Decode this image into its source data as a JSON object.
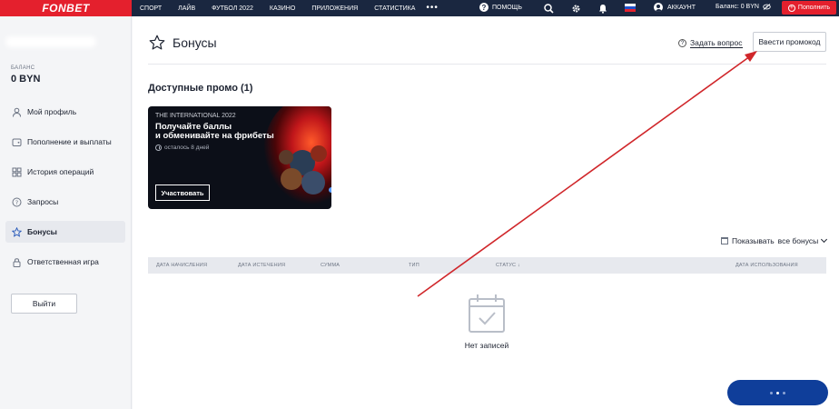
{
  "topbar": {
    "logo": "FONBET",
    "nav": [
      "СПОРТ",
      "ЛАЙВ",
      "ФУТБОЛ 2022",
      "КАЗИНО",
      "ПРИЛОЖЕНИЯ",
      "СТАТИСТИКА"
    ],
    "more": "•••",
    "help": "ПОМОЩЬ",
    "account": "АККАУНТ",
    "balance": "Баланс: 0 BYN",
    "deposit": "Пополнить",
    "icons": [
      "help-icon",
      "search-icon",
      "gear-icon",
      "bell-icon",
      "flag-icon",
      "account-icon",
      "eye-off-icon",
      "plus-circle-icon"
    ],
    "flag_colors": [
      "#ffffff",
      "#1e50c8",
      "#e4202d"
    ]
  },
  "sidebar": {
    "balance_label": "БАЛАНС",
    "balance_value": "0 BYN",
    "items": [
      {
        "label": "Мой профиль",
        "icon": "user-icon"
      },
      {
        "label": "Пополнение и выплаты",
        "icon": "wallet-icon"
      },
      {
        "label": "История операций",
        "icon": "grid-icon"
      },
      {
        "label": "Запросы",
        "icon": "question-icon"
      },
      {
        "label": "Бонусы",
        "icon": "star-icon",
        "active": true
      },
      {
        "label": "Ответственная игра",
        "icon": "lock-icon"
      }
    ],
    "logout": "Выйти"
  },
  "page": {
    "title": "Бонусы",
    "ask": "Задать вопрос",
    "promo_button": "Ввести промокод",
    "available_promos": "Доступные промо (1)"
  },
  "promo_card": {
    "event": "THE INTERNATIONAL 2022",
    "title_line1": "Получайте баллы",
    "title_line2": "и обменивайте на фрибеты",
    "time_left": "осталось 8 дней",
    "button": "Участвовать"
  },
  "filter": {
    "label": "Показывать",
    "value": "все бонусы"
  },
  "table": {
    "columns": [
      "ДАТА НАЧИСЛЕНИЯ",
      "ДАТА ИСТЕЧЕНИЯ",
      "СУММА",
      "ТИП",
      "СТАТУС ↓",
      "ДАТА ИСПОЛЬЗОВАНИЯ"
    ]
  },
  "empty": {
    "text": "Нет записей"
  },
  "colors": {
    "brand_red": "#e4202d",
    "nav_dark": "#1a2740",
    "loader_blue": "#0f3e9a",
    "annotation_arrow": "#d0262a"
  }
}
